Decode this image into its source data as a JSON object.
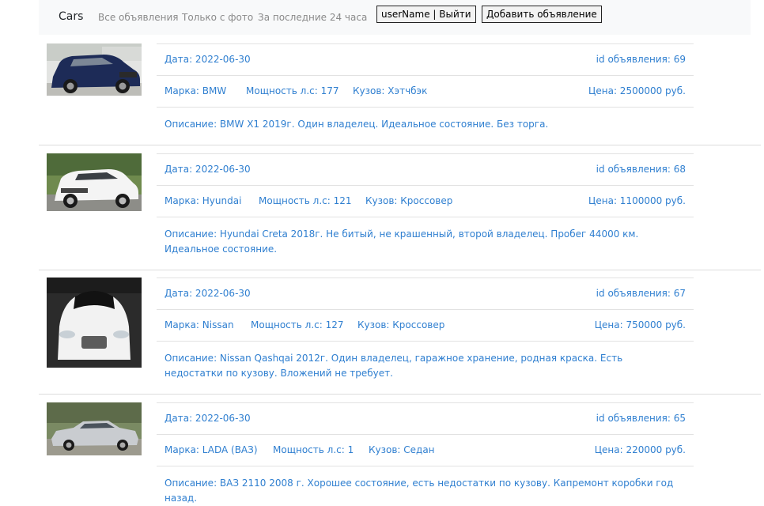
{
  "navbar": {
    "brand": "Cars",
    "links": [
      "Все объявления",
      "Только с фото",
      "За последние 24 часа"
    ],
    "user_button": "userName | Выйти",
    "add_button": "Добавить объявление"
  },
  "colors": {
    "link": "#2f7fd0",
    "navbar_bg": "#f8f9fa"
  },
  "listings": [
    {
      "date": "Дата: 2022-06-30",
      "id": "id объявления: 69",
      "brand": "Марка: BMW",
      "power": "Мощность л.с: 177",
      "body": "Кузов: Хэтчбэк",
      "price": "Цена: 2500000 руб.",
      "description": "Описание: BMW X1 2019г. Один владелец. Идеальное состояние. Без торга."
    },
    {
      "date": "Дата: 2022-06-30",
      "id": "id объявления: 68",
      "brand": "Марка: Hyundai",
      "power": "Мощность л.с: 121",
      "body": "Кузов: Кроссовер",
      "price": "Цена: 1100000 руб.",
      "description": "Описание: Hyundai Creta 2018г. Не битый, не крашенный, второй владелец. Пробег 44000 км. Идеальное состояние."
    },
    {
      "date": "Дата: 2022-06-30",
      "id": "id объявления: 67",
      "brand": "Марка: Nissan",
      "power": "Мощность л.с: 127",
      "body": "Кузов: Кроссовер",
      "price": "Цена: 750000 руб.",
      "description": "Описание: Nissan Qashqai 2012г. Один владелец, гаражное хранение, родная краска. Есть недостатки по кузову. Вложений не требует."
    },
    {
      "date": "Дата: 2022-06-30",
      "id": "id объявления: 65",
      "brand": "Марка: LADA (ВАЗ)",
      "power": "Мощность л.с: 1",
      "body": "Кузов: Седан",
      "price": "Цена: 220000 руб.",
      "description": "Описание: ВАЗ 2110 2008 г. Хорошее состояние, есть недостатки по кузову. Капремонт коробки год назад."
    }
  ]
}
